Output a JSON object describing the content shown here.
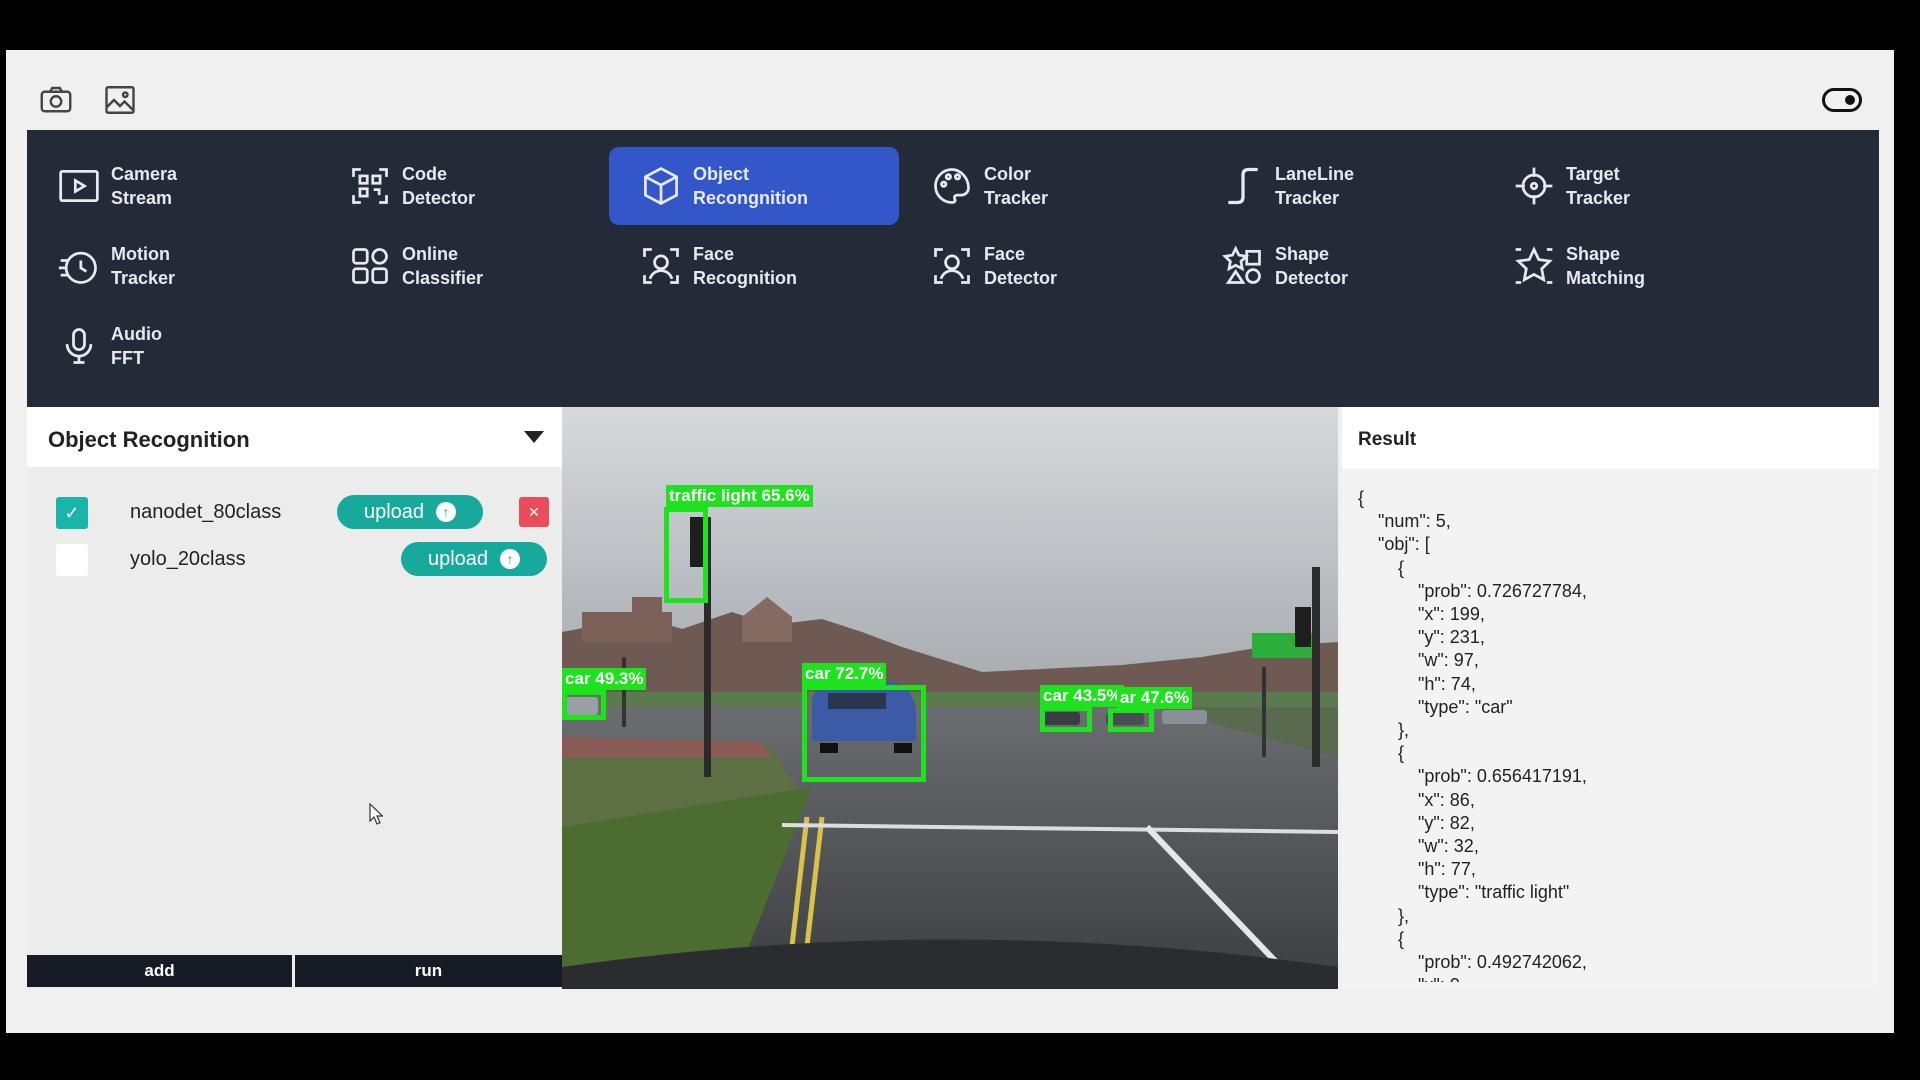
{
  "nav": {
    "items": [
      {
        "label": "Camera\nStream",
        "icon": "camera-stream-icon",
        "active": false
      },
      {
        "label": "Code\nDetector",
        "icon": "qr-code-icon",
        "active": false
      },
      {
        "label": "Object\nRecongnition",
        "icon": "cube-icon",
        "active": true
      },
      {
        "label": "Color\nTracker",
        "icon": "palette-icon",
        "active": false
      },
      {
        "label": "LaneLine\nTracker",
        "icon": "lane-line-icon",
        "active": false
      },
      {
        "label": "Target\nTracker",
        "icon": "crosshair-icon",
        "active": false
      },
      {
        "label": "Motion\nTracker",
        "icon": "motion-icon",
        "active": false
      },
      {
        "label": "Online\nClassifier",
        "icon": "grid-icon",
        "active": false
      },
      {
        "label": "Face\nRecognition",
        "icon": "face-recognition-icon",
        "active": false
      },
      {
        "label": "Face\nDetector",
        "icon": "face-detector-icon",
        "active": false
      },
      {
        "label": "Shape\nDetector",
        "icon": "shapes-icon",
        "active": false
      },
      {
        "label": "Shape\nMatching",
        "icon": "star-match-icon",
        "active": false
      },
      {
        "label": "Audio\nFFT",
        "icon": "microphone-icon",
        "active": false
      }
    ]
  },
  "panel": {
    "title": "Object Recognition",
    "models": [
      {
        "name": "nanodet_80class",
        "checked": true,
        "upload_label": "upload",
        "deletable": true
      },
      {
        "name": "yolo_20class",
        "checked": false,
        "upload_label": "upload",
        "deletable": false
      }
    ],
    "add_label": "add",
    "run_label": "run"
  },
  "detections": [
    {
      "label": "traffic light 65.6%"
    },
    {
      "label": "car 49.3%"
    },
    {
      "label": "car 72.7%"
    },
    {
      "label": "car 43.5%"
    },
    {
      "label": "ar 47.6%"
    }
  ],
  "result": {
    "title": "Result",
    "text": "{\n    \"num\": 5,\n    \"obj\": [\n        {\n            \"prob\": 0.726727784,\n            \"x\": 199,\n            \"y\": 231,\n            \"w\": 97,\n            \"h\": 74,\n            \"type\": \"car\"\n        },\n        {\n            \"prob\": 0.656417191,\n            \"x\": 86,\n            \"y\": 82,\n            \"w\": 32,\n            \"h\": 77,\n            \"type\": \"traffic light\"\n        },\n        {\n            \"prob\": 0.492742062,\n            \"x\": 0,"
  },
  "colors": {
    "nav_bg": "#232a38",
    "nav_active": "#3357c9",
    "teal": "#17a99c",
    "danger": "#e94c5a",
    "detection": "#1de21d"
  }
}
